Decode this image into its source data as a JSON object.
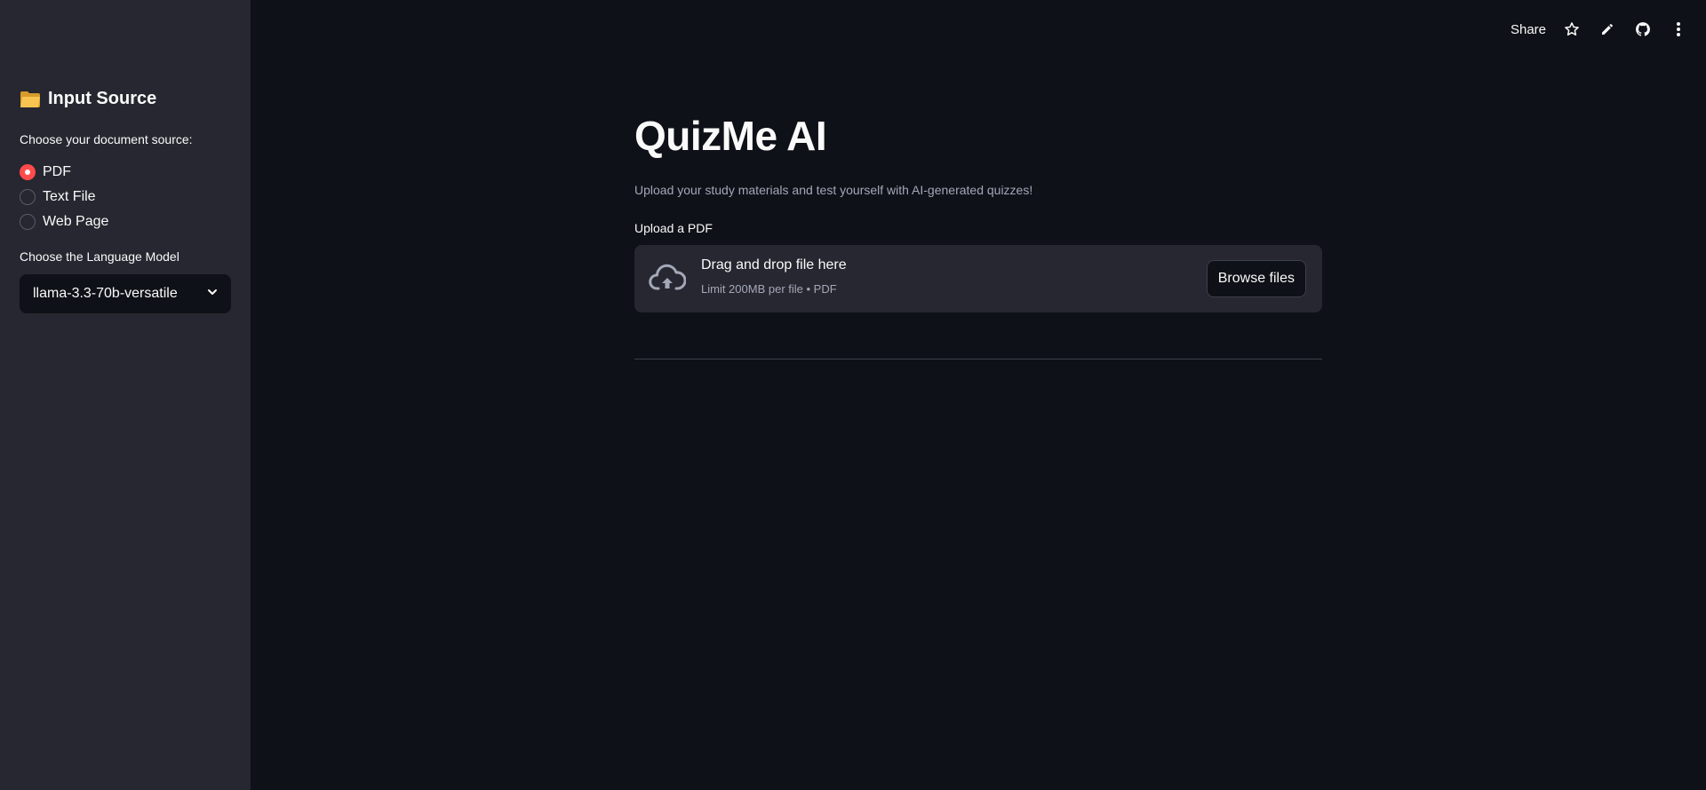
{
  "sidebar": {
    "header_icon": "folder-icon",
    "header": "Input Source",
    "source_label": "Choose your document source:",
    "source_options": [
      {
        "label": "PDF",
        "selected": true
      },
      {
        "label": "Text File",
        "selected": false
      },
      {
        "label": "Web Page",
        "selected": false
      }
    ],
    "model_label": "Choose the Language Model",
    "model_value": "llama-3.3-70b-versatile"
  },
  "toolbar": {
    "share_label": "Share",
    "icons": [
      "star-icon",
      "pencil-icon",
      "github-icon",
      "more-vertical-icon"
    ]
  },
  "main": {
    "title": "QuizMe AI",
    "subtitle": "Upload your study materials and test yourself with AI-generated quizzes!",
    "upload_label": "Upload a PDF",
    "dropzone": {
      "icon": "cloud-upload-icon",
      "title": "Drag and drop file here",
      "limit": "Limit 200MB per file • PDF",
      "browse_label": "Browse files"
    }
  },
  "colors": {
    "background": "#0e1117",
    "sidebar": "#262730",
    "accent": "#ff4b4b",
    "muted_text": "#a3a8b8"
  }
}
